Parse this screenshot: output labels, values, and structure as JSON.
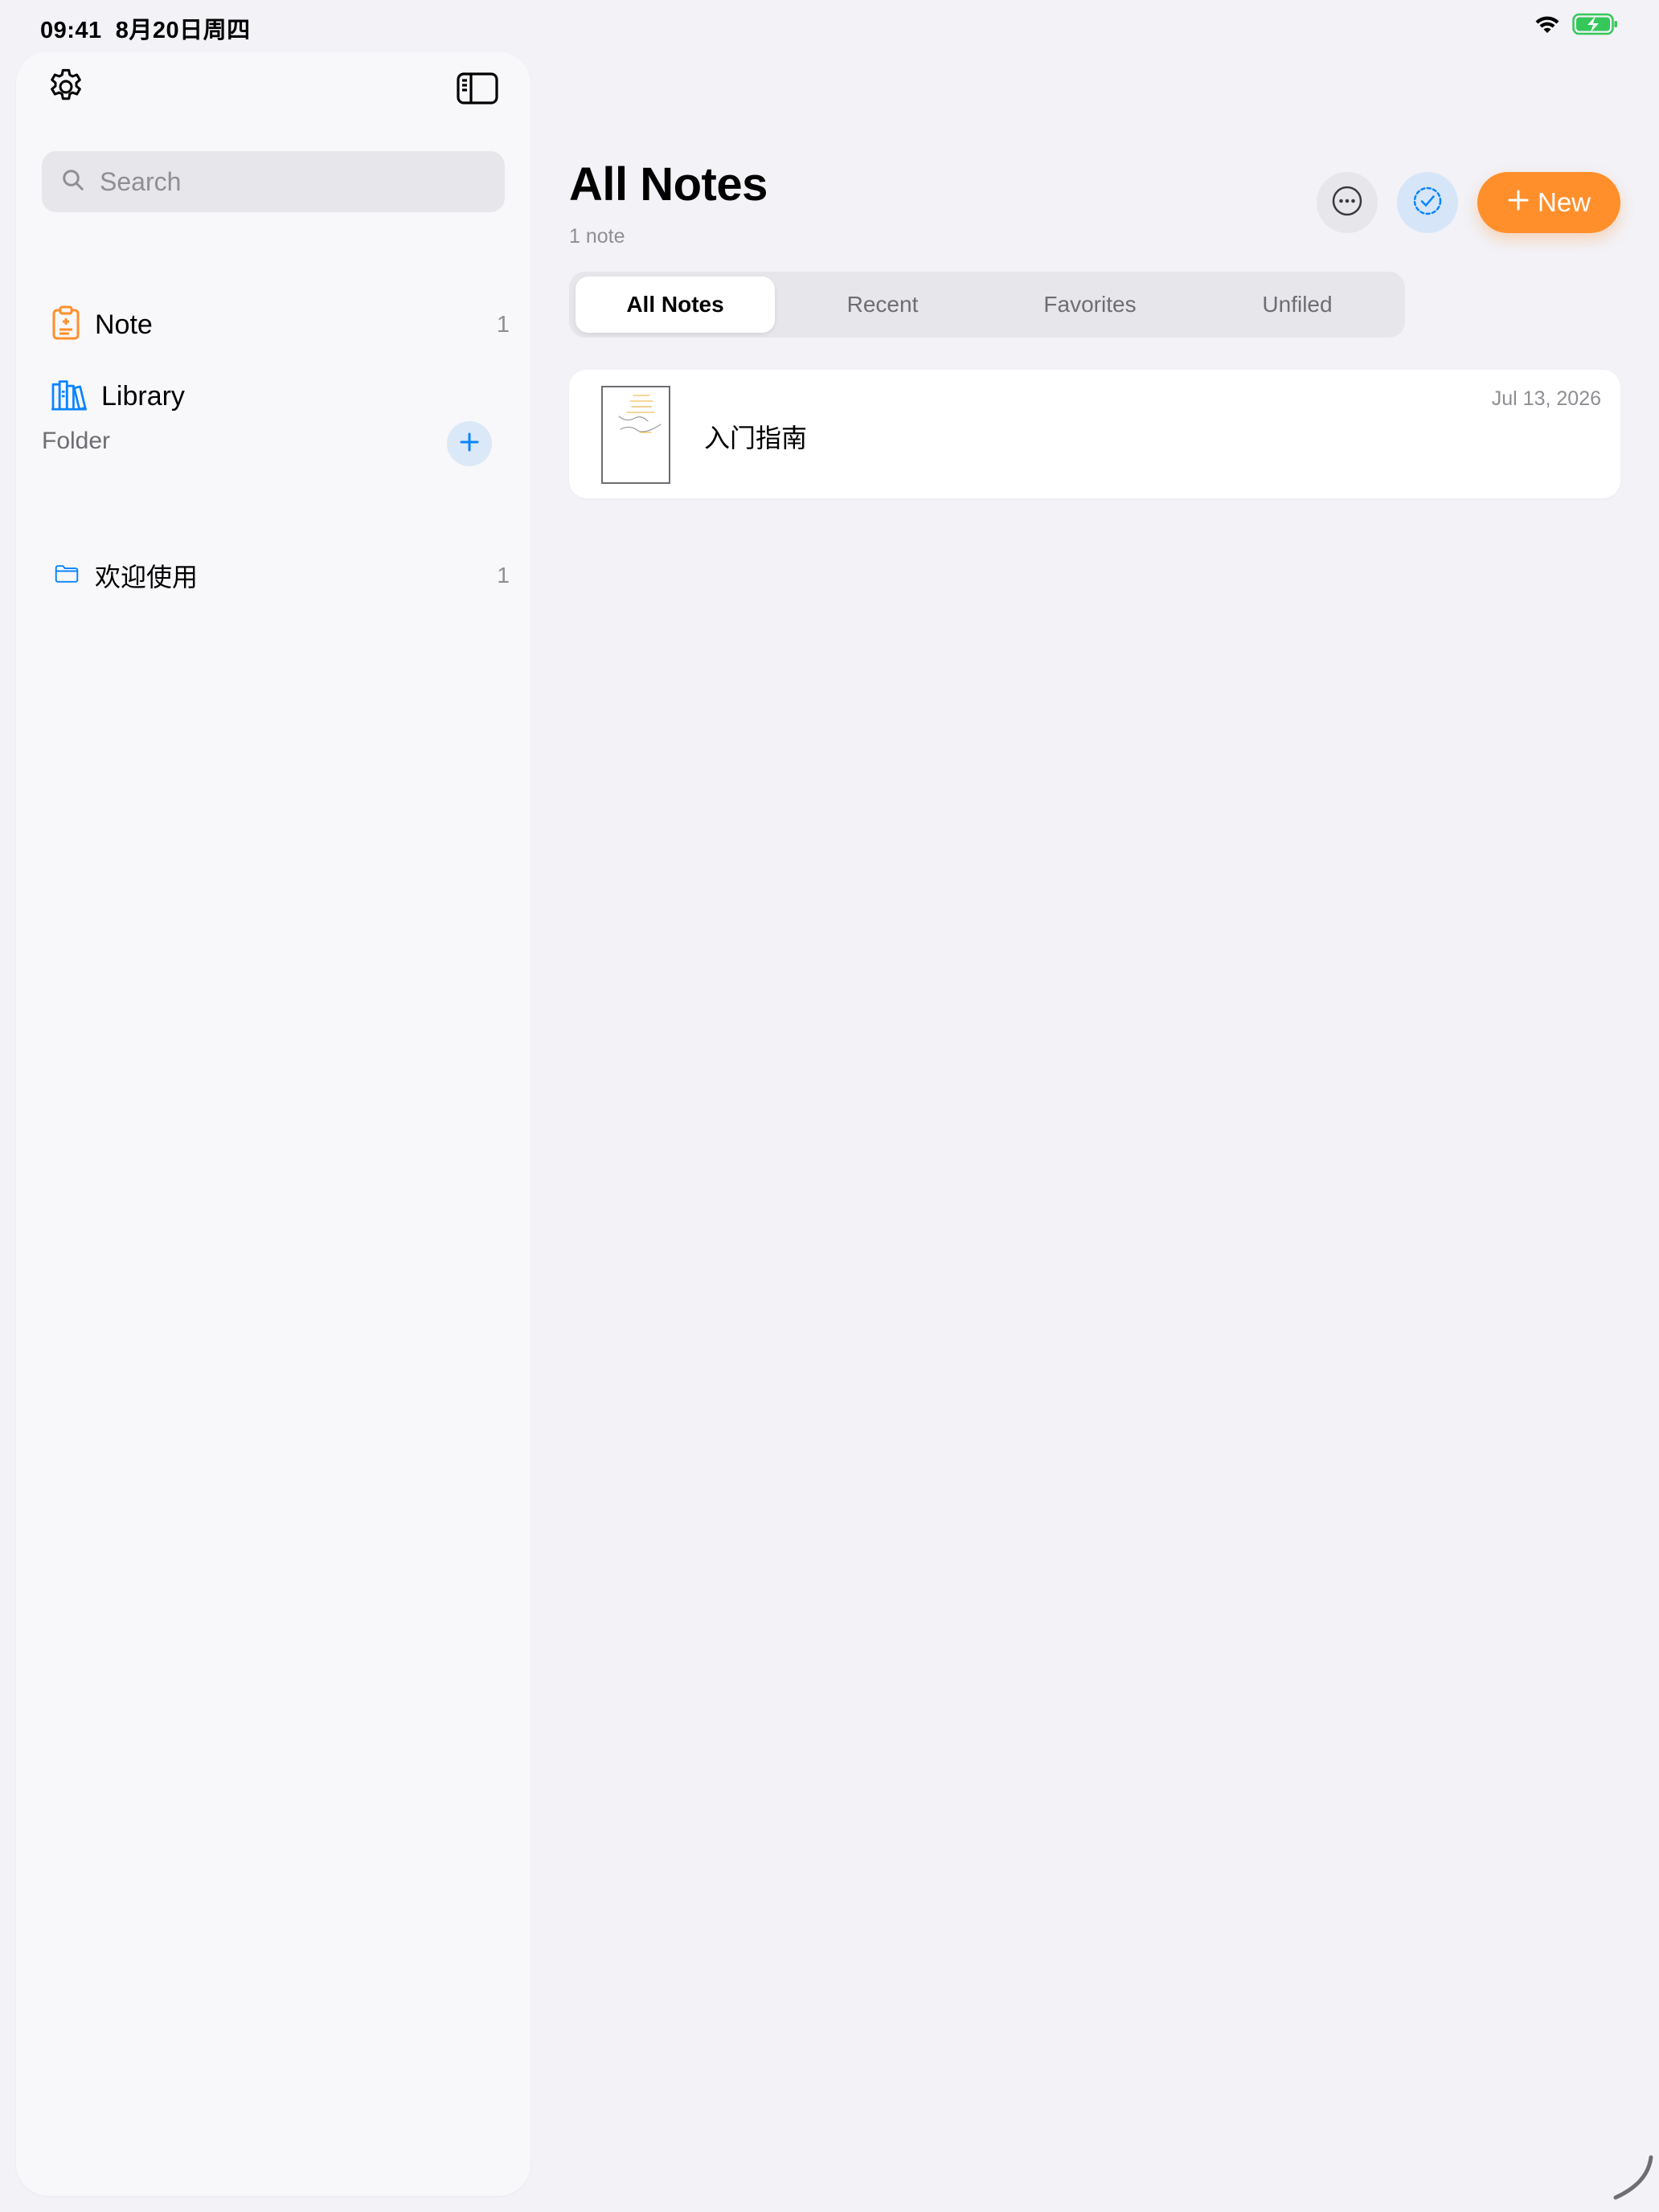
{
  "status_bar": {
    "time": "09:41",
    "date": "8月20日周四",
    "battery_color": "#34c759"
  },
  "sidebar": {
    "search_placeholder": "Search",
    "items": [
      {
        "label": "Note",
        "count": "1",
        "icon": "clipboard-icon",
        "color": "#ff8f2b"
      },
      {
        "label": "Library",
        "count": "",
        "icon": "books-icon",
        "color": "#0a84ff"
      }
    ],
    "folder_section_label": "Folder",
    "folders": [
      {
        "label": "欢迎使用",
        "count": "1",
        "icon": "folder-icon"
      }
    ]
  },
  "main": {
    "title": "All Notes",
    "subtitle": "1 note",
    "new_button_label": "New",
    "accent_color": "#ff8f2b",
    "tabs": [
      {
        "label": "All Notes",
        "active": true
      },
      {
        "label": "Recent",
        "active": false
      },
      {
        "label": "Favorites",
        "active": false
      },
      {
        "label": "Unfiled",
        "active": false
      }
    ],
    "notes": [
      {
        "title": "入门指南",
        "date": "Jul 13, 2026"
      }
    ]
  }
}
